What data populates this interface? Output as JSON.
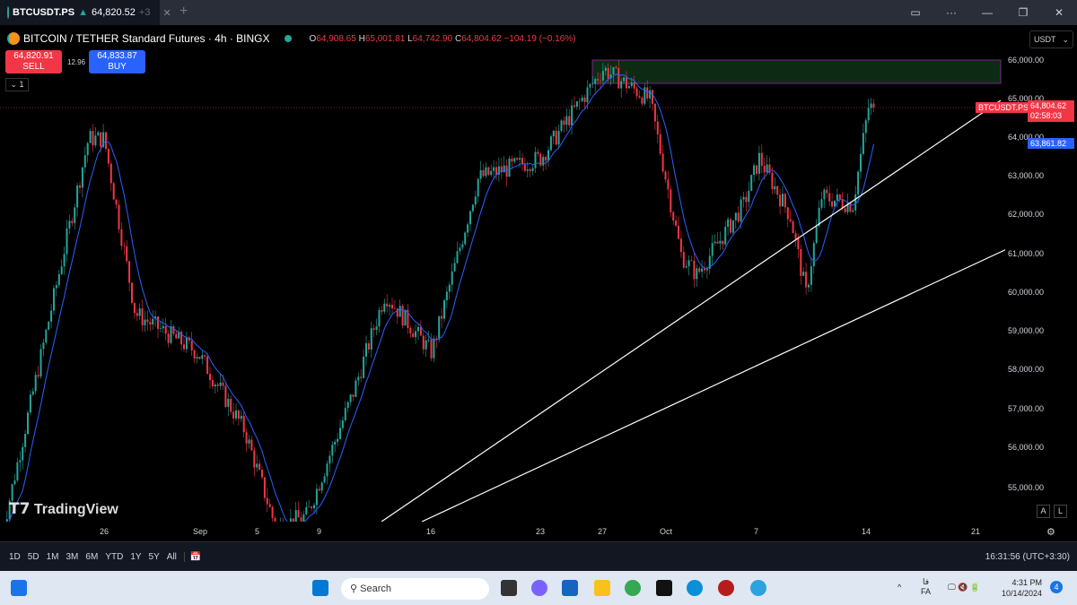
{
  "tab": {
    "symbol": "BTCUSDT.PS",
    "price": "64,820.52",
    "change": "+3"
  },
  "legend": {
    "title": "BITCOIN / TETHER Standard Futures · 4h · BINGX",
    "o": "64,908.65",
    "h": "65,001.81",
    "l": "64,742.90",
    "c": "64,804.62",
    "chg": "−104.19 (−0.16%)"
  },
  "trade": {
    "sell_price": "64,820.91",
    "sell_label": "SELL",
    "spread": "12.96",
    "buy_price": "64,833.87",
    "buy_label": "BUY"
  },
  "indicator_toggle": "1",
  "currency": "USDT",
  "price_axis": [
    "66,000.00",
    "65,000.00",
    "64,000.00",
    "63,000.00",
    "62,000.00",
    "61,000.00",
    "60,000.00",
    "59,000.00",
    "58,000.00",
    "57,000.00",
    "56,000.00",
    "55,000.00"
  ],
  "time_axis": [
    "26",
    "Sep",
    "5",
    "9",
    "16",
    "23",
    "27",
    "Oct",
    "7",
    "14",
    "21"
  ],
  "tags": {
    "symbol": "BTCUSDT.PS",
    "last": "64,804.62",
    "countdown": "02:58:03",
    "ma": "63,861.82"
  },
  "watermark": "TradingView",
  "scale_buttons": {
    "auto": "A",
    "log": "L"
  },
  "ranges": [
    "1D",
    "5D",
    "1M",
    "3M",
    "6M",
    "YTD",
    "1Y",
    "5Y",
    "All"
  ],
  "clock": "16:31:56 (UTC+3:30)",
  "taskbar": {
    "search": "Search",
    "lang": "FA",
    "lang_native": "فا",
    "time": "4:31 PM",
    "date": "10/14/2024",
    "notif": "4"
  },
  "colors": {
    "up": "#26a69a",
    "down": "#f23645",
    "ma": "#2962ff",
    "zone": "#0d2a14"
  },
  "chart_data": {
    "type": "candlestick",
    "timeframe": "4h",
    "ylim": [
      54500,
      66500
    ],
    "close_path": [
      [
        "Aug 22",
        58500
      ],
      [
        "Aug 25",
        64000
      ],
      [
        "Aug 26",
        64000
      ],
      [
        "Aug 28",
        59500
      ],
      [
        "Sep 1",
        58500
      ],
      [
        "Sep 4",
        56500
      ],
      [
        "Sep 6",
        54000
      ],
      [
        "Sep 8",
        54300
      ],
      [
        "Sep 11",
        57500
      ],
      [
        "Sep 13",
        60000
      ],
      [
        "Sep 16",
        58500
      ],
      [
        "Sep 17",
        60000
      ],
      [
        "Sep 19",
        63000
      ],
      [
        "Sep 23",
        63500
      ],
      [
        "Sep 27",
        65800
      ],
      [
        "Sep 30",
        65000
      ],
      [
        "Oct 2",
        61000
      ],
      [
        "Oct 3",
        60500
      ],
      [
        "Oct 6",
        62300
      ],
      [
        "Oct 7",
        63500
      ],
      [
        "Oct 9",
        62000
      ],
      [
        "Oct 10",
        60000
      ],
      [
        "Oct 11",
        62500
      ],
      [
        "Oct 13",
        62300
      ],
      [
        "Oct 14",
        64805
      ]
    ],
    "last": 64804.62,
    "ma_last": 63861.82
  }
}
